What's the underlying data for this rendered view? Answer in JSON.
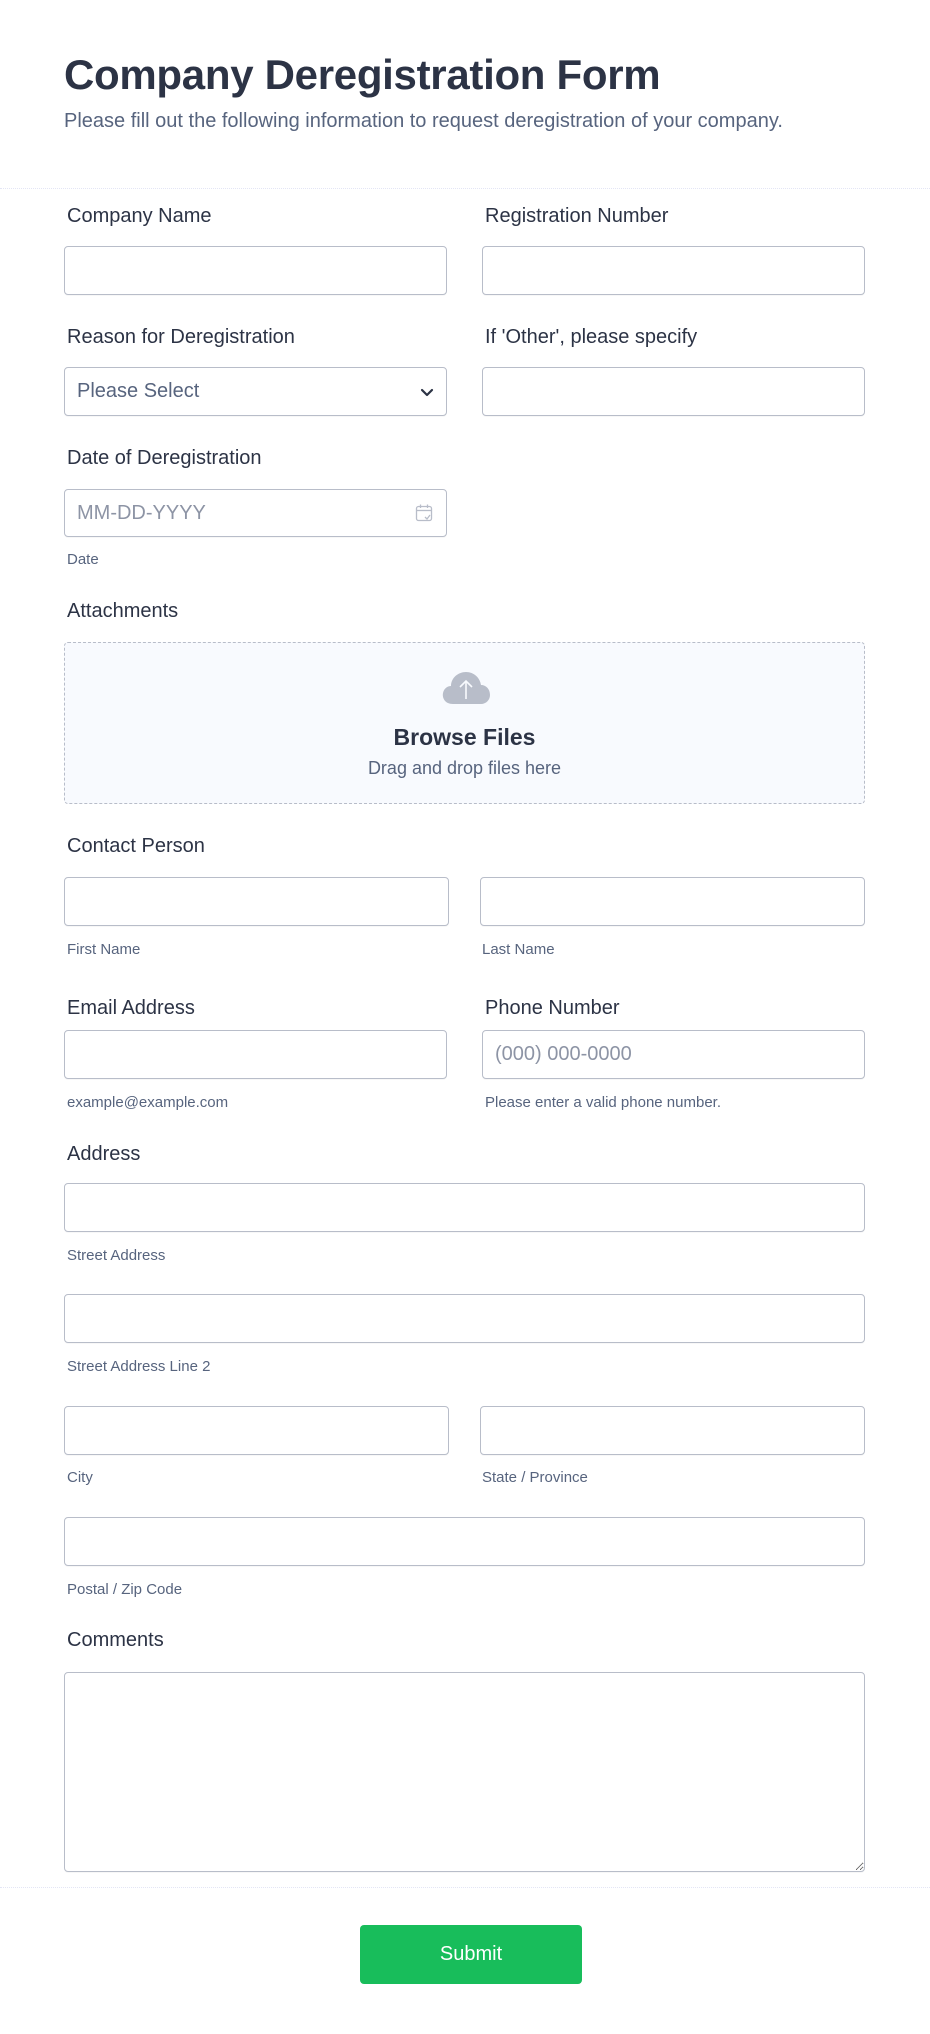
{
  "header": {
    "title": "Company Deregistration Form",
    "subtitle": "Please fill out the following information to request deregistration of your company."
  },
  "fields": {
    "company_name": {
      "label": "Company Name",
      "value": ""
    },
    "registration_number": {
      "label": "Registration Number",
      "value": ""
    },
    "reason": {
      "label": "Reason for Deregistration",
      "selected": "Please Select",
      "icon": "chevron-down-icon"
    },
    "other_specify": {
      "label": "If 'Other', please specify",
      "value": ""
    },
    "date": {
      "label": "Date of Deregistration",
      "placeholder": "MM-DD-YYYY",
      "sublabel": "Date",
      "icon": "calendar-icon"
    },
    "attachments": {
      "label": "Attachments",
      "browse": "Browse Files",
      "hint": "Drag and drop files here",
      "icon": "cloud-upload-icon"
    },
    "contact": {
      "label": "Contact Person",
      "first_sublabel": "First Name",
      "last_sublabel": "Last Name",
      "first_value": "",
      "last_value": ""
    },
    "email": {
      "label": "Email Address",
      "value": "",
      "sublabel": "example@example.com"
    },
    "phone": {
      "label": "Phone Number",
      "placeholder": "(000) 000-0000",
      "sublabel": "Please enter a valid phone number."
    },
    "address": {
      "label": "Address",
      "street_sublabel": "Street Address",
      "street2_sublabel": "Street Address Line 2",
      "city_sublabel": "City",
      "state_sublabel": "State / Province",
      "zip_sublabel": "Postal / Zip Code"
    },
    "comments": {
      "label": "Comments",
      "value": ""
    }
  },
  "actions": {
    "submit_label": "Submit"
  },
  "colors": {
    "accent": "#18bd5b",
    "text": "#2c3345",
    "muted": "#57647e",
    "border": "#b8bdc9",
    "dropzone_bg": "#f8fafe"
  }
}
